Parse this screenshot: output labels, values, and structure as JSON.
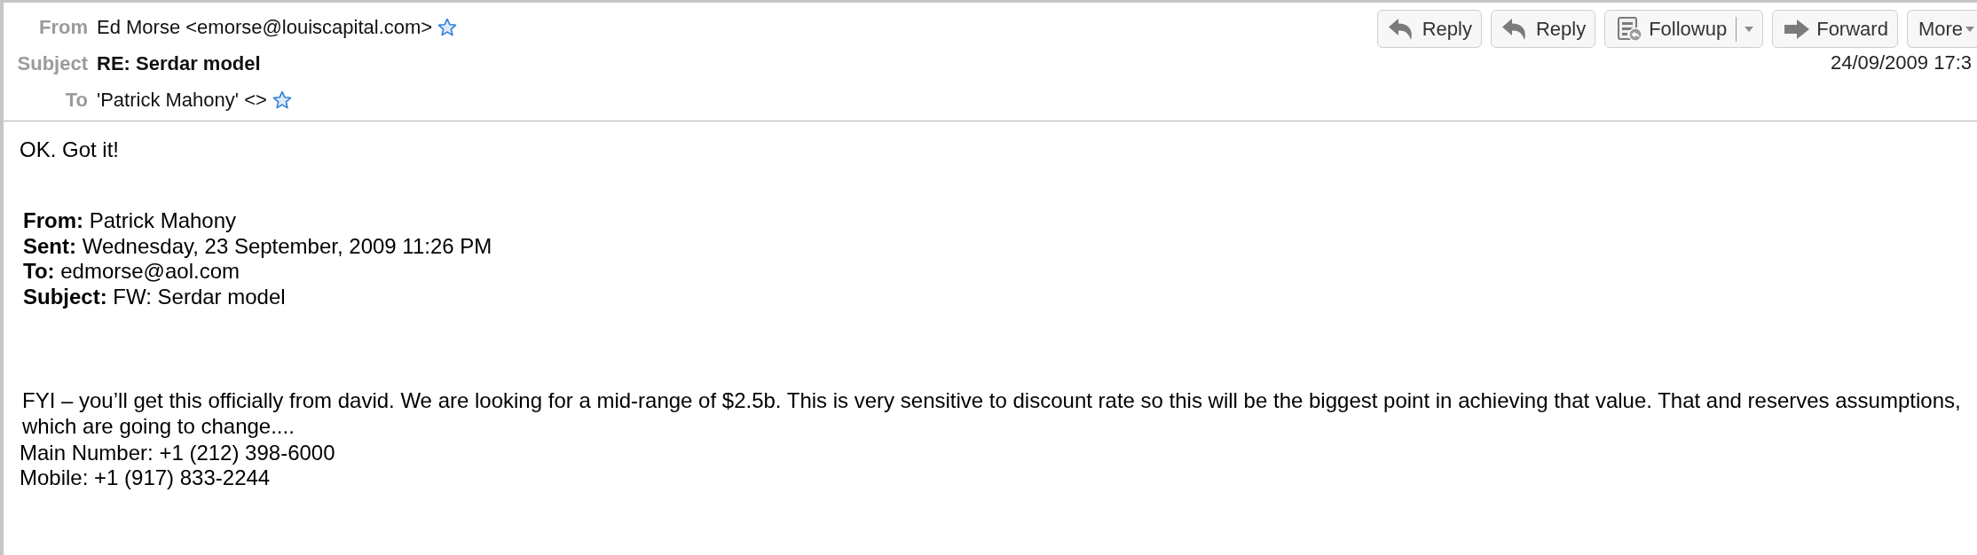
{
  "header": {
    "fields": [
      {
        "label": "From",
        "value": "Ed Morse <emorse@louiscapital.com>",
        "kind": "address"
      },
      {
        "label": "Subject",
        "value": "RE: Serdar model",
        "kind": "subject"
      },
      {
        "label": "To",
        "value": "'Patrick Mahony' <>",
        "kind": "address"
      }
    ],
    "buttons": [
      {
        "label": "Reply",
        "kind": "reply"
      },
      {
        "label": "Reply",
        "kind": "reply"
      },
      {
        "label": "Followup",
        "kind": "followup"
      },
      {
        "label": "Forward",
        "kind": "forward"
      },
      {
        "label": "More",
        "kind": "more"
      }
    ],
    "date": "24/09/2009 17:3"
  },
  "body": {
    "reply_text": "OK. Got it!",
    "quoted_header": [
      "**From:** Patrick Mahony",
      "**Sent:** Wednesday, 23 September, 2009 11:26 PM",
      "**To:** edmorse@aol.com",
      "**Subject:** FW: Serdar model"
    ],
    "forwarded_text": "FYI – you’ll get this officially from david. We are looking for a mid-range of $2.5b. This is very sensitive to discount rate so this will be the biggest point in achieving that value. That and reserves assumptions, which are going to change....",
    "signature": [
      "Main Number: +1 (212) 398-6000",
      "Mobile: +1 (917) 833-2244"
    ]
  }
}
